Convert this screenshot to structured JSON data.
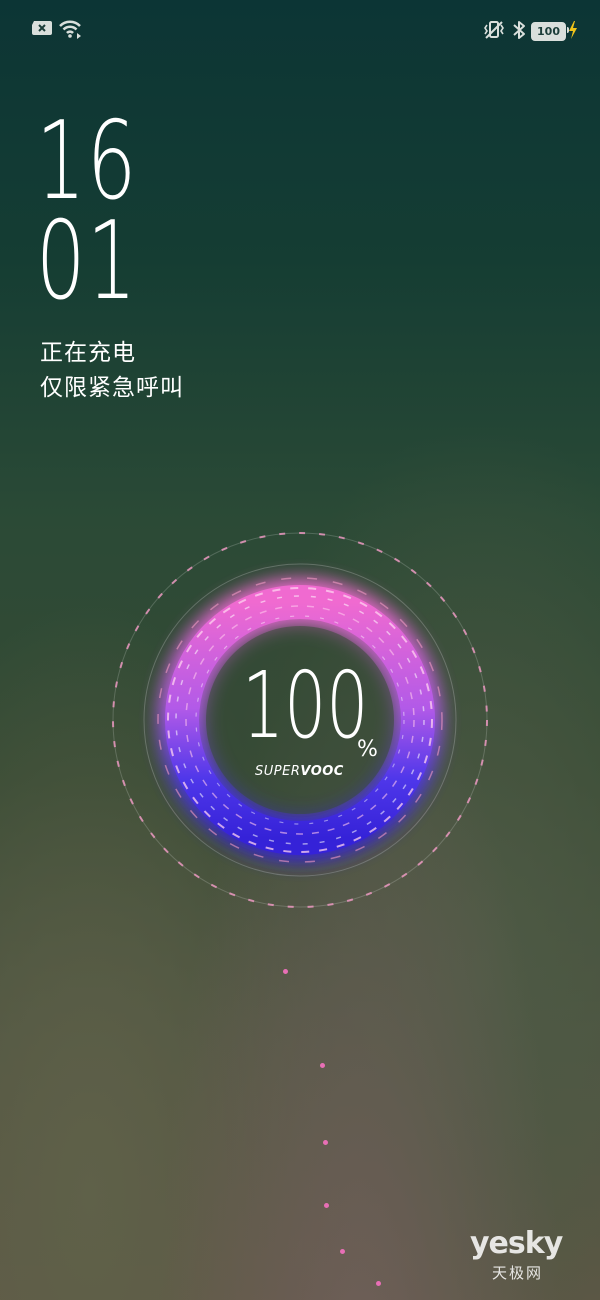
{
  "status_bar": {
    "left_icons": [
      "no-sim-icon",
      "wifi-icon"
    ],
    "right_icons": [
      "vibrate-icon",
      "bluetooth-icon",
      "battery-icon",
      "charging-bolt-icon"
    ],
    "battery_level": "100"
  },
  "lock_screen": {
    "clock_hour": "16",
    "clock_minute": "01",
    "charging_status": "正在充电",
    "emergency_notice": "仅限紧急呼叫"
  },
  "charging": {
    "percent": "100",
    "percent_sign": "%",
    "brand_prefix": "SUPER",
    "brand_suffix": "VOOC",
    "level_fraction": 1.0
  },
  "watermark": {
    "logo_text": "yesky",
    "logo_cn": "天极网"
  },
  "colors": {
    "ring_pink": "#e85fc8",
    "ring_blue": "#3f2fe0",
    "dash_pink": "#f39ac5",
    "bolt": "#f0c419"
  }
}
